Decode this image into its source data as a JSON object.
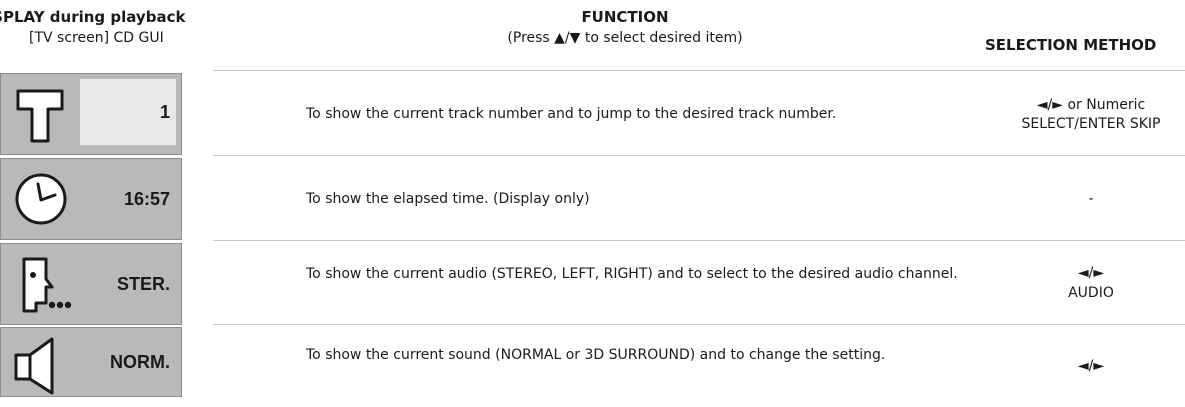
{
  "header": {
    "col1_title": "s DISPLAY during playback",
    "col1_sub": "[TV screen] CD GUI",
    "col2_title": "FUNCTION",
    "col2_sub": "(Press ▲/▼ to select desired item)",
    "col3_title": "SELECTION METHOD"
  },
  "rows": [
    {
      "icon": "track-icon",
      "gui_value": "1",
      "function": "To show the current track number and to jump to the desired track number.",
      "selection_line1": "◄/► or Numeric",
      "selection_line2": "SELECT/ENTER  SKIP"
    },
    {
      "icon": "clock-icon",
      "gui_value": "16:57",
      "function": "To show the elapsed time. (Display only)",
      "selection_line1": "-",
      "selection_line2": ""
    },
    {
      "icon": "audio-speaking-icon",
      "gui_value": "STER.",
      "function": "To show the current audio (STEREO, LEFT, RIGHT) and to select to the desired audio channel.",
      "selection_line1": "◄/►",
      "selection_line2": "AUDIO"
    },
    {
      "icon": "speaker-icon",
      "gui_value": "NORM.",
      "function": "To show the current sound (NORMAL or 3D SURROUND) and to change the setting.",
      "selection_line1": "◄/►",
      "selection_line2": ""
    }
  ],
  "colors": {
    "panel_bg": "#b9b9b9",
    "field_bg": "#e9e9e9",
    "separator": "#c9c9c9"
  }
}
